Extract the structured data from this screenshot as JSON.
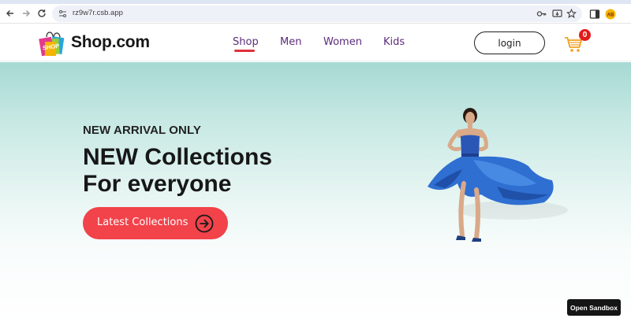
{
  "browser": {
    "url": "rz9w7r.csb.app",
    "icons": [
      "back-arrow-icon",
      "forward-arrow-icon",
      "reload-icon",
      "site-info-icon",
      "password-key-icon",
      "install-app-icon",
      "bookmark-star-icon",
      "side-panel-icon",
      "profile-avatar-icon"
    ]
  },
  "header": {
    "logo_text": "SHOP",
    "brand": "Shop.com",
    "nav": [
      {
        "label": "Shop",
        "active": true
      },
      {
        "label": "Men",
        "active": false
      },
      {
        "label": "Women",
        "active": false
      },
      {
        "label": "Kids",
        "active": false
      }
    ],
    "login_label": "login",
    "cart_count": "0"
  },
  "hero": {
    "eyebrow": "NEW ARRIVAL ONLY",
    "headline_line1": "NEW Collections",
    "headline_line2": "For everyone",
    "cta_label": "Latest Collections"
  },
  "sandbox": {
    "label": "Open Sandbox"
  },
  "colors": {
    "accent": "#f2424a",
    "nav_text": "#5b2c7a",
    "active_underline": "#e0303b",
    "hero_top": "#a6d9d3",
    "cart_badge": "#e21b1b"
  }
}
